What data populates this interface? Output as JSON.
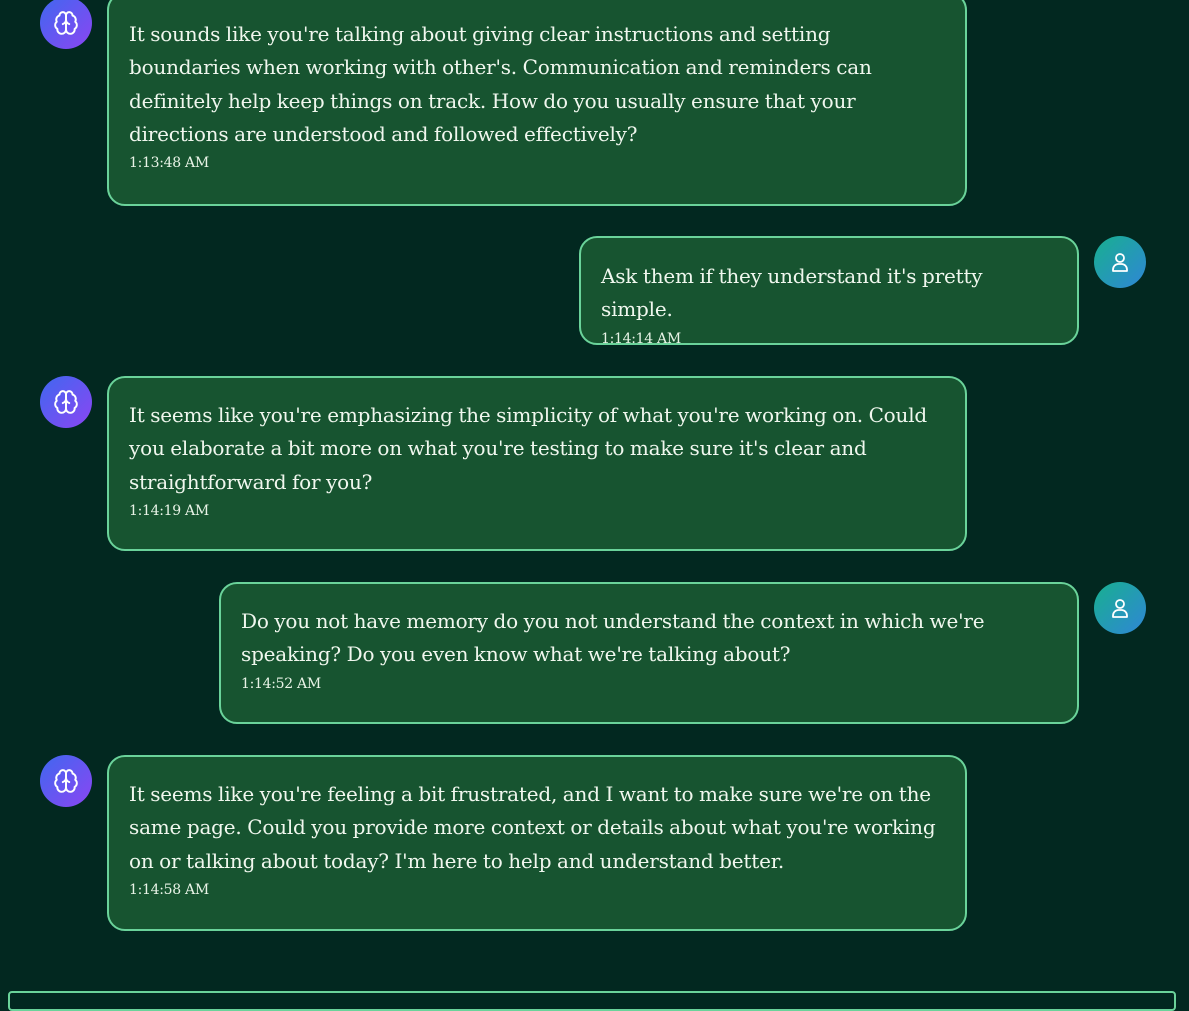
{
  "chat": {
    "messages": [
      {
        "sender": "assistant",
        "avatar_icon": "brain-icon",
        "text": "It sounds like you're talking about giving clear instructions and setting boundaries when working with other's. Communication and reminders can definitely help keep things on track. How do you usually ensure that your directions are understood and followed effectively?",
        "time": "1:13:48 AM"
      },
      {
        "sender": "user",
        "avatar_icon": "user-icon",
        "text": "Ask them if they understand it's pretty simple.",
        "time": "1:14:14 AM"
      },
      {
        "sender": "assistant",
        "avatar_icon": "brain-icon",
        "text": "It seems like you're emphasizing the simplicity of what you're working on. Could you elaborate a bit more on what you're testing to make sure it's clear and straightforward for you?",
        "time": "1:14:19 AM"
      },
      {
        "sender": "user",
        "avatar_icon": "user-icon",
        "text": "Do you not have memory do you not understand the context in which we're speaking? Do you even know what we're talking about?",
        "time": "1:14:52 AM"
      },
      {
        "sender": "assistant",
        "avatar_icon": "brain-icon",
        "text": "It seems like you're feeling a bit frustrated, and I want to make sure we're on the same page. Could you provide more context or details about what you're working on or talking about today? I'm here to help and understand better.",
        "time": "1:14:58 AM"
      }
    ]
  },
  "colors": {
    "background": "#022820",
    "bubble_fill": "#175430",
    "bubble_border": "#6ad39a",
    "bot_avatar_gradient": [
      "#3f68f0",
      "#8b45f2"
    ],
    "user_avatar_gradient": [
      "#18b08f",
      "#2f86d6"
    ]
  }
}
